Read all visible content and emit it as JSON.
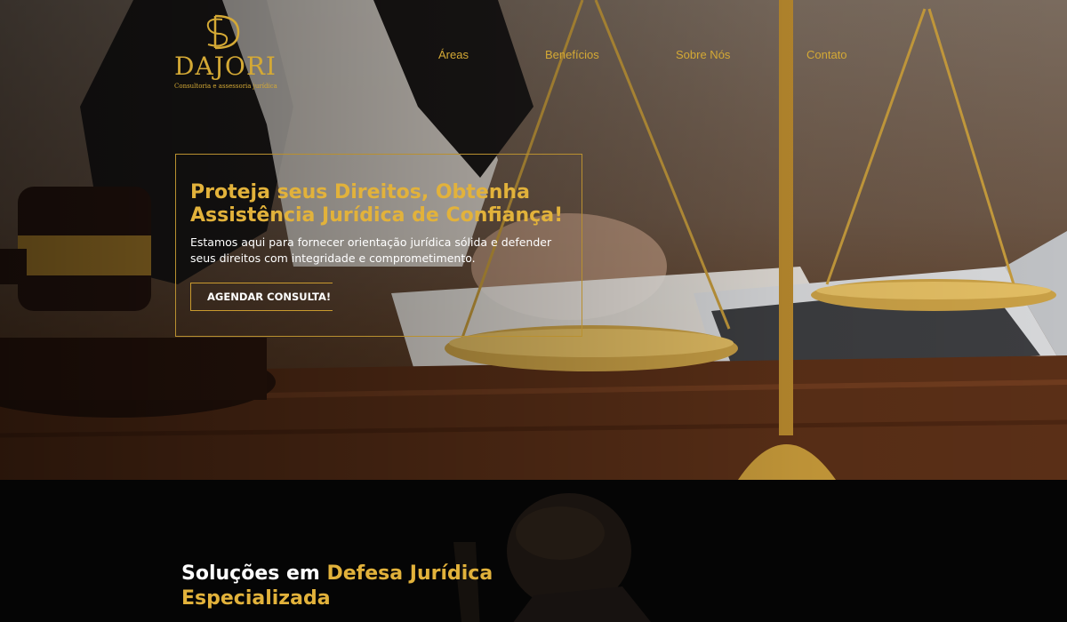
{
  "brand": {
    "name": "DAJORI",
    "tagline": "Consultoria e assessoria jurídica",
    "accent": "#d4a935"
  },
  "nav": {
    "items": [
      {
        "label": "Áreas"
      },
      {
        "label": "Benefícios"
      },
      {
        "label": "Sobre Nós"
      },
      {
        "label": "Contato"
      }
    ]
  },
  "hero": {
    "title": "Proteja seus Direitos, Obtenha Assistência Jurídica de Confiança!",
    "subtitle": "Estamos aqui para fornecer orientação jurídica sólida e defender seus direitos com integridade e comprometimento.",
    "cta_label": "AGENDAR CONSULTA!"
  },
  "section": {
    "title_white": "Soluções em ",
    "title_gold": "Defesa Jurídica Especializada"
  }
}
